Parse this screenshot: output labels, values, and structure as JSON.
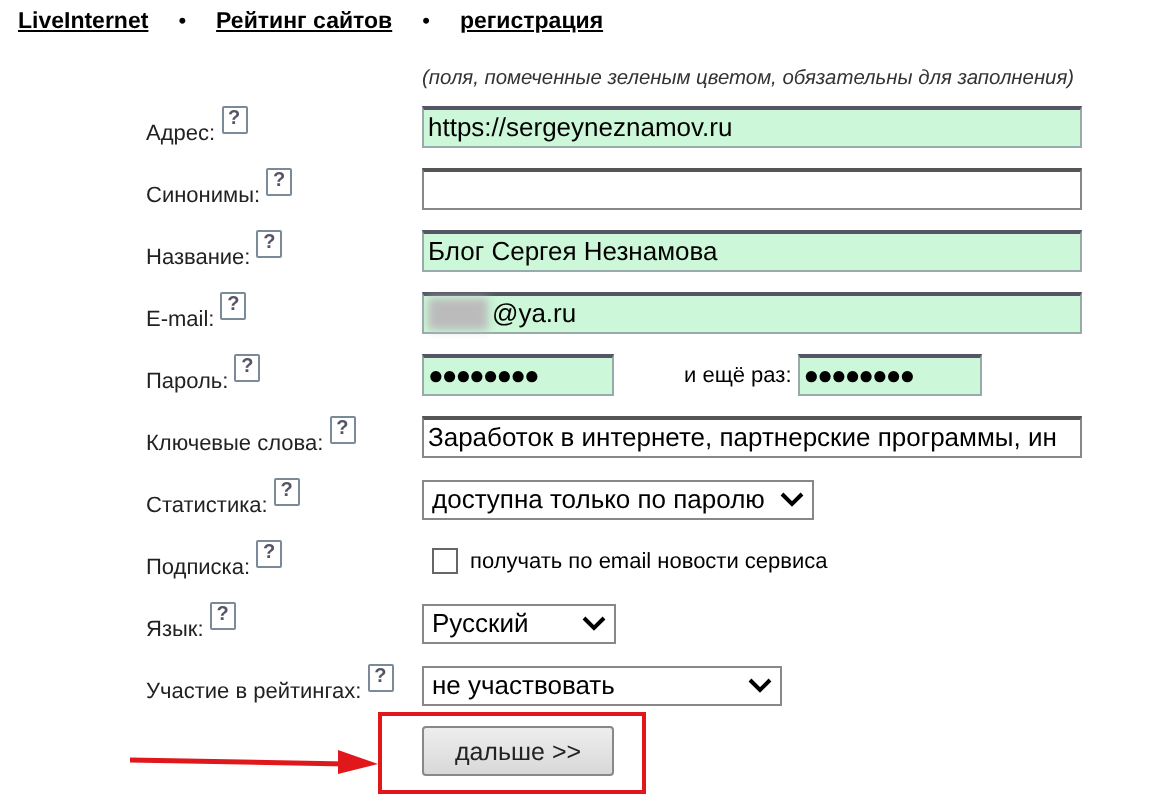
{
  "nav": {
    "separator": "•",
    "links": [
      {
        "label": "LiveInternet"
      },
      {
        "label": "Рейтинг сайтов"
      },
      {
        "label": "регистрация"
      }
    ]
  },
  "note": "(поля, помеченные зеленым цветом, обязательны для заполнения)",
  "rows": [
    {
      "kind": "text",
      "label": "Адрес:",
      "help": "?",
      "required": true,
      "value": "https://sergeyneznamov.ru"
    },
    {
      "kind": "text",
      "label": "Синонимы:",
      "help": "?",
      "required": false
    },
    {
      "kind": "text",
      "label": "Название:",
      "help": "?",
      "required": true,
      "value": "Блог Сергея Незнамова"
    },
    {
      "kind": "email",
      "label": "E-mail:",
      "help": "?",
      "required": true,
      "value": "@ya.ru"
    },
    {
      "kind": "password",
      "label": "Пароль:",
      "help": "?",
      "required": true,
      "value": "●●●●●●●●",
      "repeat_label": "и ещё раз:",
      "repeat_value": "●●●●●●●●"
    },
    {
      "kind": "text",
      "label": "Ключевые слова:",
      "help": "?",
      "required": false,
      "value": "Заработок в интернете, партнерские программы, ин"
    },
    {
      "kind": "select",
      "label": "Статистика:",
      "help": "?",
      "value": "доступна только по паролю"
    },
    {
      "kind": "checkbox",
      "label": "Подписка:",
      "help": "?",
      "checked": false,
      "text": "получать по email новости сервиса"
    },
    {
      "kind": "select",
      "label": "Язык:",
      "help": "?",
      "value": "Русский"
    },
    {
      "kind": "select",
      "label": "Участие в рейтингах:",
      "help": "?",
      "value": "не участвовать"
    }
  ],
  "submit": "дальше >>"
}
